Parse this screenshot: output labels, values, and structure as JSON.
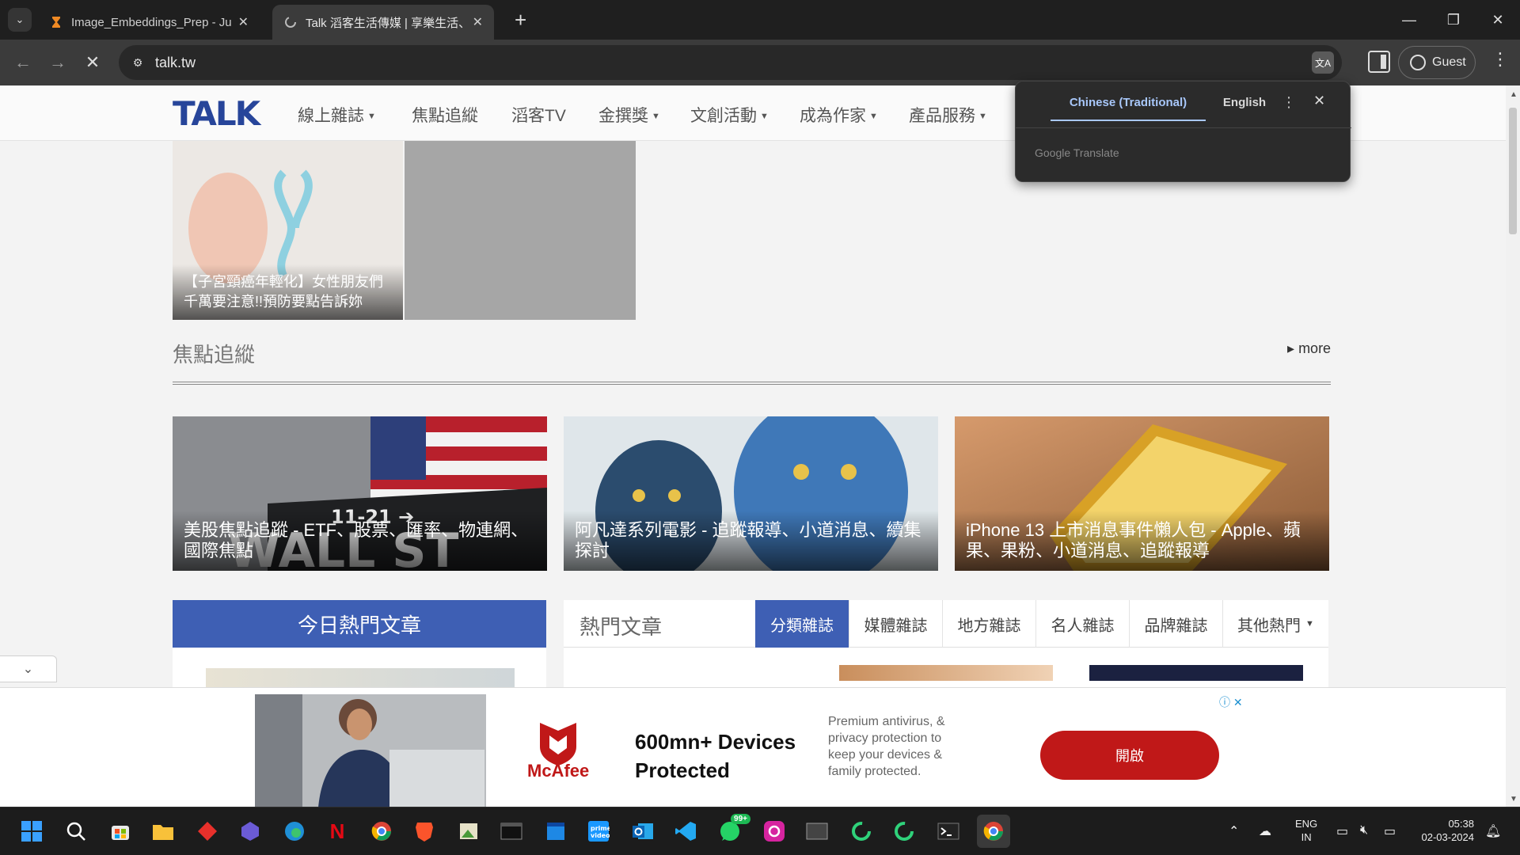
{
  "browser": {
    "tabs": [
      {
        "title": "Image_Embeddings_Prep - Jupy",
        "favicon": "hourglass-icon",
        "active": false
      },
      {
        "title": "Talk 滔客生活傳媒 | 享樂生活、",
        "favicon": "loading-spinner-icon",
        "active": true
      }
    ],
    "url": "talk.tw",
    "profile_label": "Guest"
  },
  "translate_popup": {
    "source_lang": "Chinese (Traditional)",
    "target_lang": "English",
    "brand": "Google Translate"
  },
  "site": {
    "logo_text": "TALK",
    "nav": [
      {
        "label": "線上雜誌",
        "dropdown": true
      },
      {
        "label": "焦點追縱",
        "dropdown": false
      },
      {
        "label": "滔客TV",
        "dropdown": false
      },
      {
        "label": "金撰獎",
        "dropdown": true
      },
      {
        "label": "文創活動",
        "dropdown": true
      },
      {
        "label": "成為作家",
        "dropdown": true
      },
      {
        "label": "產品服務",
        "dropdown": true
      }
    ],
    "top_card_caption": "【子宮頸癌年輕化】女性朋友們千萬要注意!!預防要點告訴妳",
    "section_title": "焦點追縱",
    "more_label": "more",
    "featured": [
      {
        "caption": "美股焦點追蹤 - ETF、股票、匯率、物連網、國際焦點",
        "image": "wall-street-flag"
      },
      {
        "caption": "阿凡達系列電影 - 追蹤報導、小道消息、續集探討",
        "image": "avatar-movie"
      },
      {
        "caption": "iPhone 13 上市消息事件懶人包 - Apple、蘋果、果粉、小道消息、追蹤報導",
        "image": "iphone-gold"
      }
    ],
    "hot_today_title": "今日熱門文章",
    "hot_articles_title": "熱門文章",
    "hot_tabs": [
      "分類雜誌",
      "媒體雜誌",
      "地方雜誌",
      "名人雜誌",
      "品牌雜誌",
      "其他熱門"
    ],
    "hot_tabs_active": 0
  },
  "ad": {
    "brand": "McAfee",
    "headline_line1": "600mn+ Devices",
    "headline_line2": "Protected",
    "body": "Premium antivirus, & privacy protection to keep your devices & family protected.",
    "cta": "開啟",
    "brand_color": "#c01818"
  },
  "taskbar": {
    "badge_count": "99+",
    "lang_line1": "ENG",
    "lang_line2": "IN",
    "time": "05:38",
    "date": "02-03-2024"
  },
  "colors": {
    "accent_blue": "#3e5fb4",
    "chrome_dark": "#1f1f1f",
    "chrome_toolbar": "#3b3b3b"
  }
}
